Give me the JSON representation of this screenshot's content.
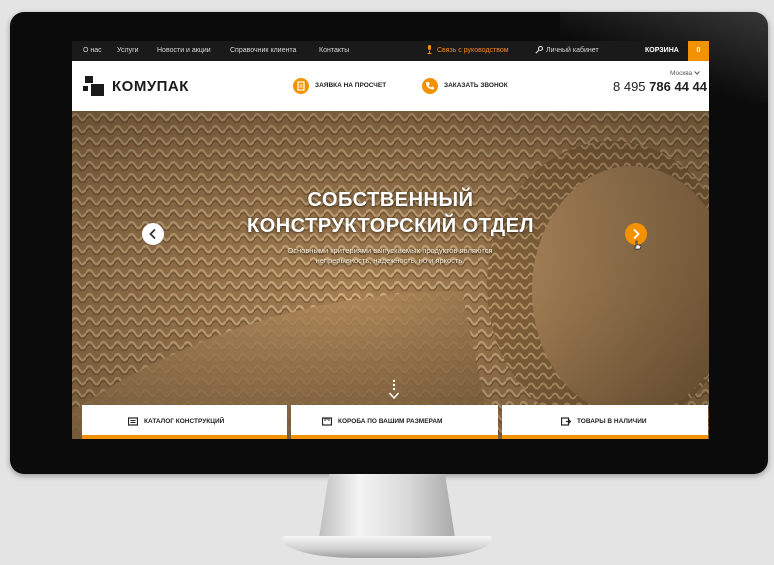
{
  "topbar": {
    "links": [
      "О нас",
      "Услуги",
      "Новости и акции",
      "Справочник клиента",
      "Контакты"
    ],
    "contact_manager": "Связь с руководством",
    "cabinet": "Личный кабинет",
    "cart_label": "КОРЗИНА",
    "cart_count": "0"
  },
  "header": {
    "logo_text": "КОМУПАК",
    "btn_estimate": "ЗАЯВКА НА ПРОСЧЕТ",
    "btn_callback": "ЗАКАЗАТЬ ЗВОНОК",
    "city": "Москва",
    "phone_prefix": "8 495",
    "phone_main": "786 44 44"
  },
  "hero": {
    "title_line1": "СОБСТВЕННЫЙ",
    "title_line2": "КОНСТРУКТОРСКИЙ ОТДЕЛ",
    "subtitle": "Основными критериями выпускаемых продуктов являются непрерывность, надежность, но и яркость."
  },
  "tabs": [
    {
      "label": "КАТАЛОГ КОНСТРУКЦИЙ",
      "icon": "catalog-icon"
    },
    {
      "label": "КОРОБА ПО ВАШИМ РАЗМЕРАМ",
      "icon": "ruler-box-icon"
    },
    {
      "label": "ТОВАРЫ В НАЛИЧИИ",
      "icon": "box-arrow-icon"
    }
  ],
  "colors": {
    "accent": "#f39200",
    "topbar": "#1a1a1a",
    "cardboard": "#9a7448"
  }
}
